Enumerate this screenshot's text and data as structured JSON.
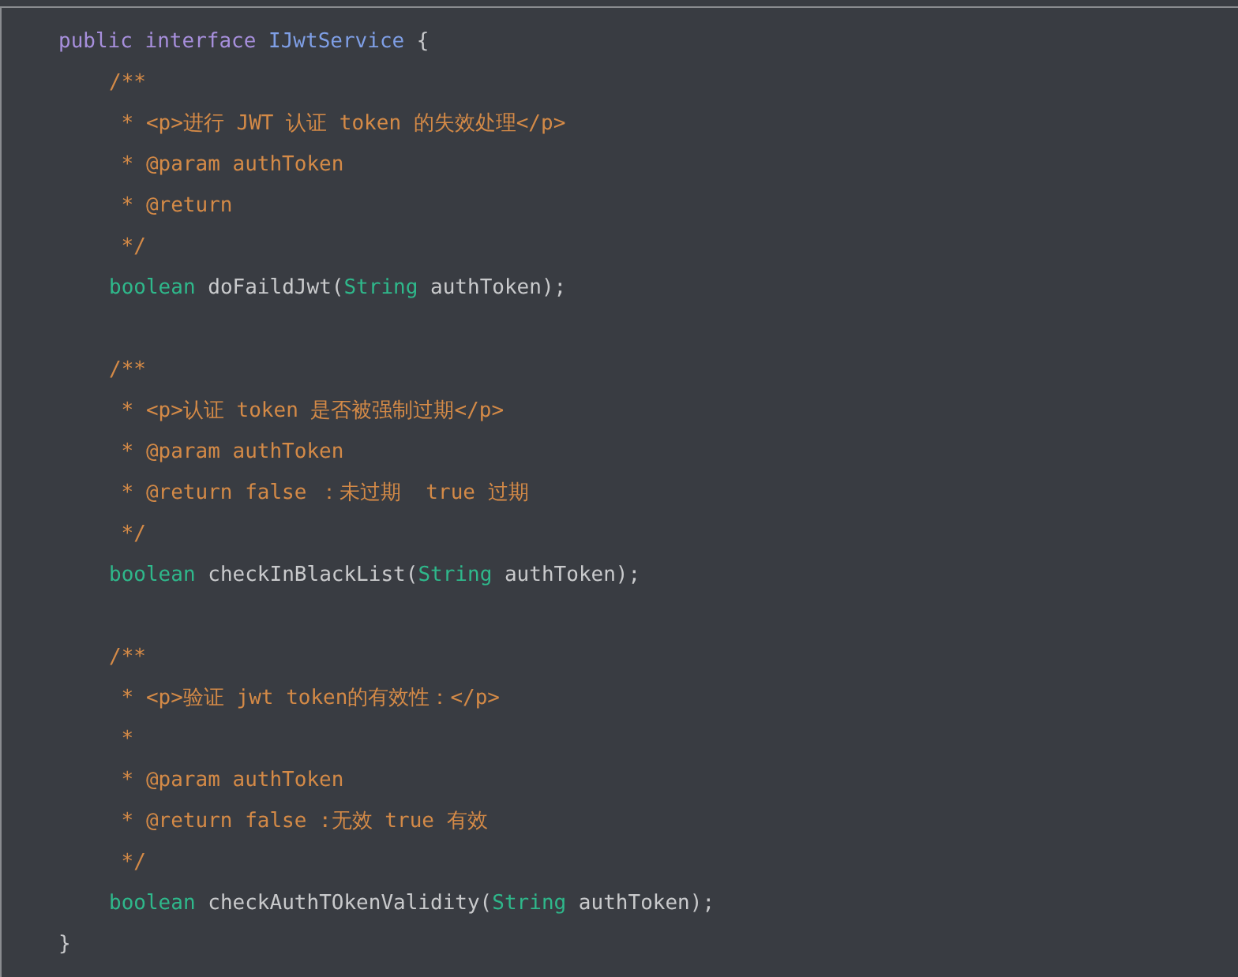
{
  "code": {
    "declaration": [
      {
        "kind": "keyword",
        "text": "public"
      },
      {
        "kind": "keyword",
        "text": "interface"
      },
      {
        "kind": "class",
        "text": "IJwtService"
      },
      {
        "kind": "plain",
        "text": "{"
      }
    ],
    "body": [
      {
        "kind": "doc-open",
        "tokens": [
          {
            "kind": "comment",
            "text": "/**"
          }
        ]
      },
      {
        "kind": "doc",
        "tokens": [
          {
            "kind": "comment",
            "text": "* <p>进行 JWT 认证 token 的失效处理</p>"
          }
        ]
      },
      {
        "kind": "doc",
        "tokens": [
          {
            "kind": "comment",
            "text": "* @param authToken"
          }
        ]
      },
      {
        "kind": "doc",
        "tokens": [
          {
            "kind": "comment",
            "text": "* @return"
          }
        ]
      },
      {
        "kind": "doc",
        "tokens": [
          {
            "kind": "comment",
            "text": "*/"
          }
        ]
      },
      {
        "kind": "code",
        "tokens": [
          {
            "kind": "type",
            "text": "boolean"
          },
          {
            "kind": "plain",
            "text": " doFaildJwt("
          },
          {
            "kind": "type",
            "text": "String"
          },
          {
            "kind": "plain",
            "text": " authToken);"
          }
        ]
      },
      {
        "kind": "blank"
      },
      {
        "kind": "doc-open",
        "tokens": [
          {
            "kind": "comment",
            "text": "/**"
          }
        ]
      },
      {
        "kind": "doc",
        "tokens": [
          {
            "kind": "comment",
            "text": "* <p>认证 token 是否被强制过期</p>"
          }
        ]
      },
      {
        "kind": "doc",
        "tokens": [
          {
            "kind": "comment",
            "text": "* @param authToken"
          }
        ]
      },
      {
        "kind": "doc",
        "tokens": [
          {
            "kind": "comment",
            "text": "* @return false ：未过期  true 过期"
          }
        ]
      },
      {
        "kind": "doc",
        "tokens": [
          {
            "kind": "comment",
            "text": "*/"
          }
        ]
      },
      {
        "kind": "code",
        "tokens": [
          {
            "kind": "type",
            "text": "boolean"
          },
          {
            "kind": "plain",
            "text": " checkInBlackList("
          },
          {
            "kind": "type",
            "text": "String"
          },
          {
            "kind": "plain",
            "text": " authToken);"
          }
        ]
      },
      {
        "kind": "blank"
      },
      {
        "kind": "doc-open",
        "tokens": [
          {
            "kind": "comment",
            "text": "/**"
          }
        ]
      },
      {
        "kind": "doc",
        "tokens": [
          {
            "kind": "comment",
            "text": "* <p>验证 jwt token的有效性：</p>"
          }
        ]
      },
      {
        "kind": "doc",
        "tokens": [
          {
            "kind": "comment",
            "text": "*"
          }
        ]
      },
      {
        "kind": "doc",
        "tokens": [
          {
            "kind": "comment",
            "text": "* @param authToken"
          }
        ]
      },
      {
        "kind": "doc",
        "tokens": [
          {
            "kind": "comment",
            "text": "* @return false :无效 true 有效"
          }
        ]
      },
      {
        "kind": "doc",
        "tokens": [
          {
            "kind": "comment",
            "text": "*/"
          }
        ]
      },
      {
        "kind": "code",
        "tokens": [
          {
            "kind": "type",
            "text": "boolean"
          },
          {
            "kind": "plain",
            "text": " checkAuthTOkenValidity("
          },
          {
            "kind": "type",
            "text": "String"
          },
          {
            "kind": "plain",
            "text": " authToken);"
          }
        ]
      }
    ],
    "closing": "}"
  }
}
